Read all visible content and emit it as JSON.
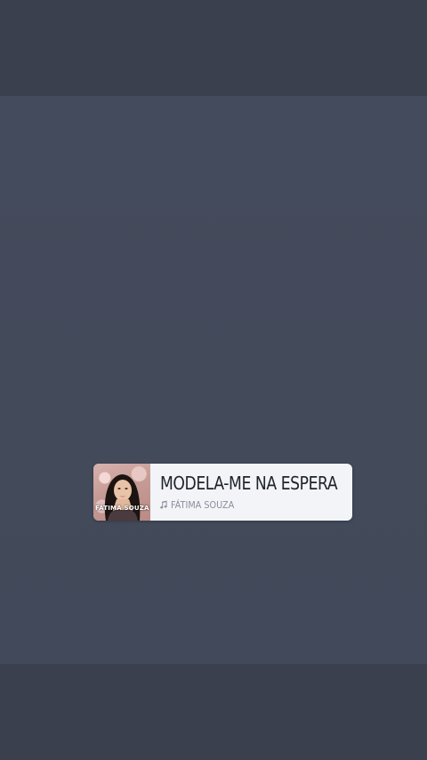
{
  "music_sticker": {
    "title": "MODELA-ME NA ESPERA",
    "artist": "FÁTIMA SOUZA",
    "album_art_text": "FÁTIMA SOUZA",
    "icon": "music-note-icon"
  },
  "colors": {
    "background": "#3c4251",
    "card_background": "#f2f4f8",
    "title_text": "#1f232b",
    "artist_text": "#8a8f99"
  }
}
